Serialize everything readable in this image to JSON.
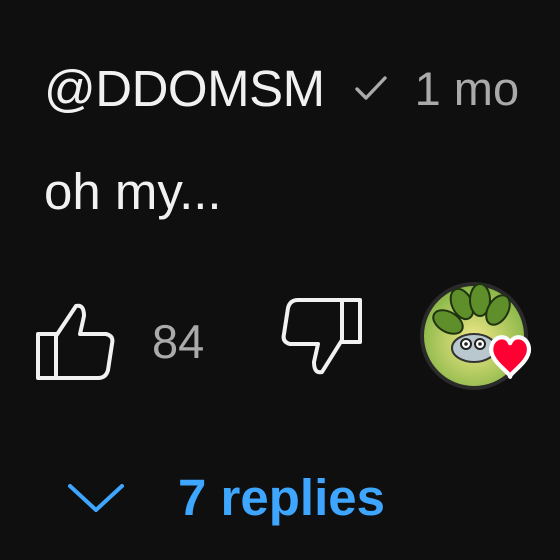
{
  "comment": {
    "author": "@DDOMSM",
    "verified_icon": "check-icon",
    "time": "1 mo",
    "text": "oh my...",
    "likes": "84",
    "like_icon": "thumbs-up-icon",
    "dislike_icon": "thumbs-down-icon",
    "creator_heart_icon": "creator-heart-icon",
    "replies": {
      "label": "7 replies",
      "icon": "chevron-down-icon"
    }
  },
  "colors": {
    "background": "#0f0f0f",
    "text": "#f1f1f1",
    "secondary_text": "#aaaaaa",
    "link": "#3ea6ff",
    "heart": "#ff0033"
  }
}
